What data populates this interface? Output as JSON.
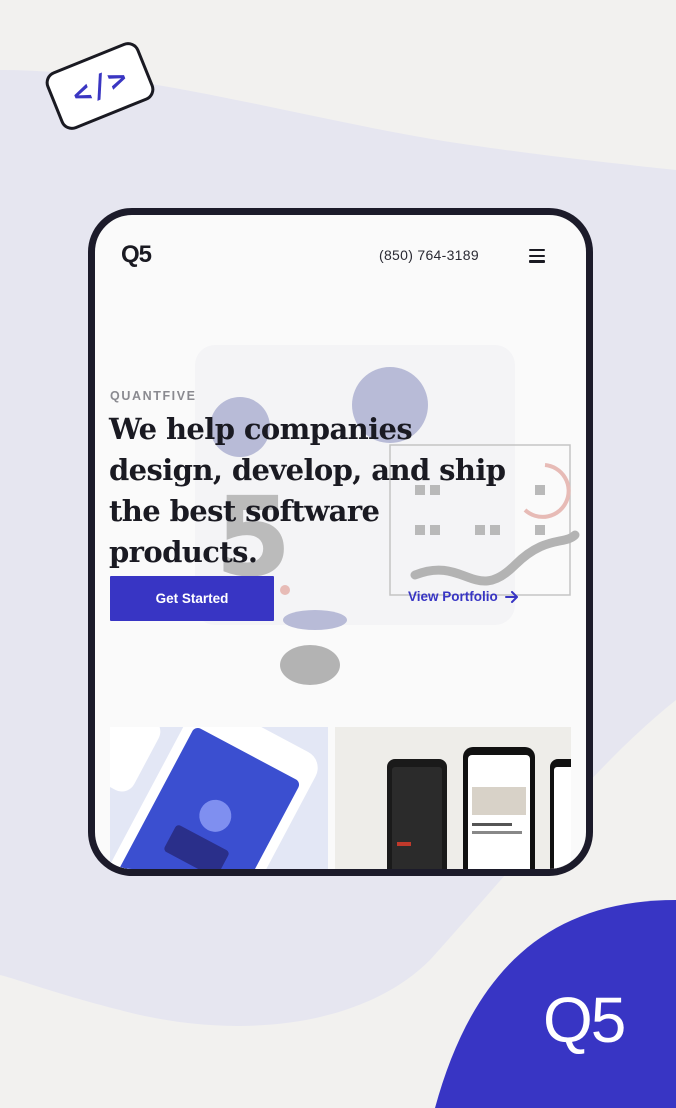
{
  "decor": {
    "code_badge_text": "</>",
    "corner_logo": "Q5",
    "accent_color": "#3835c4",
    "background_blob_color": "#e6e6f0"
  },
  "site": {
    "logo": "Q5",
    "phone": "(850) 764-3189",
    "menu_icon": "hamburger-menu-icon",
    "eyebrow": "QUANTFIVE",
    "headline": "We help companies design, develop, and ship the best software products.",
    "cta_primary": "Get Started",
    "cta_secondary": "View Portfolio",
    "cta_secondary_icon": "arrow-right-icon"
  }
}
